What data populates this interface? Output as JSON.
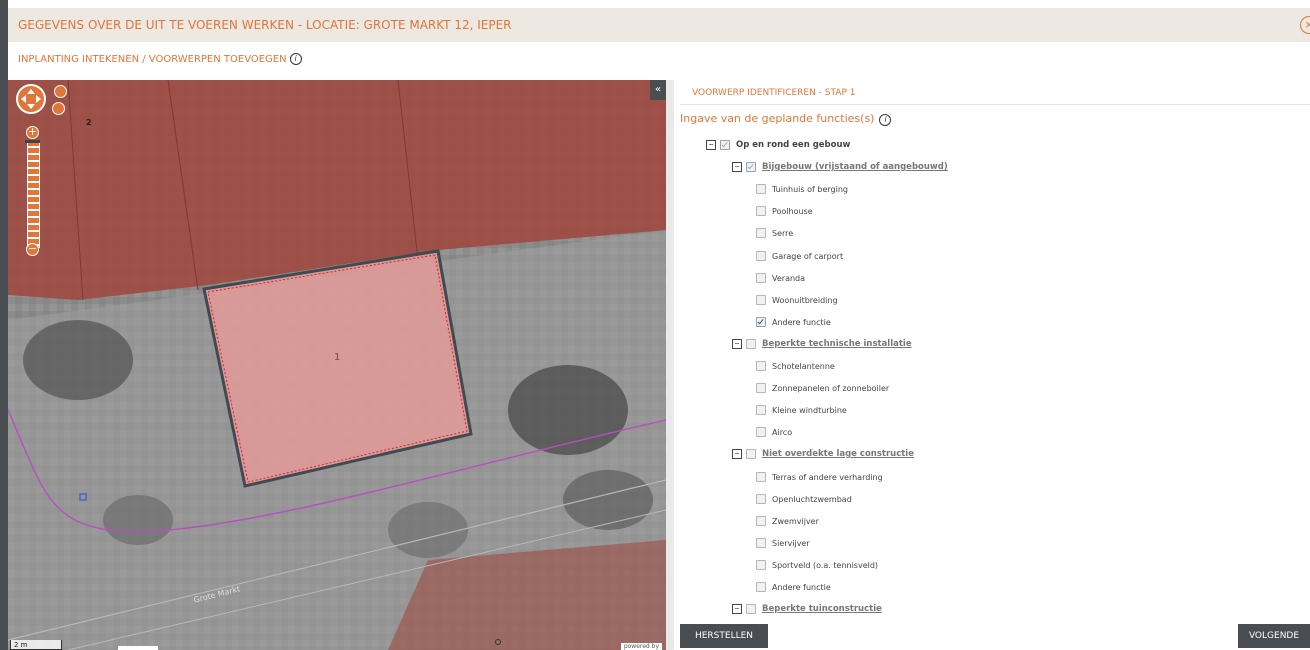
{
  "header": {
    "title": "GEGEVENS OVER DE UIT TE VOEREN WERKEN - LOCATIE: GROTE MARKT 12, IEPER",
    "close_icon": "close-icon"
  },
  "subtitle": {
    "text": "INPLANTING INTEKENEN / VOORWERPEN TOEVOEGEN",
    "info_glyph": "i"
  },
  "map": {
    "street_label": "Grote Markt",
    "parcel_number": "2",
    "object_number": "1",
    "scale_label": "2 m",
    "powered_by": "powered by",
    "collapse_glyph": "«"
  },
  "panel": {
    "step_title": "VOORWERP IDENTIFICEREN - STAP 1",
    "question": "Ingave van de geplande functies(s)",
    "info_glyph": "i",
    "tree": [
      {
        "label": "Op en rond een gebouw",
        "style": "bold",
        "level": 0,
        "toggle": "−",
        "checked": true,
        "grey": true
      },
      {
        "label": "Bijgebouw (vrijstaand of aangebouwd)",
        "style": "link",
        "level": 1,
        "toggle": "−",
        "checked": true,
        "grey": true
      },
      {
        "label": "Tuinhuis of berging",
        "style": "",
        "level": 2,
        "checked": false
      },
      {
        "label": "Poolhouse",
        "style": "",
        "level": 2,
        "checked": false
      },
      {
        "label": "Serre",
        "style": "",
        "level": 2,
        "checked": false
      },
      {
        "label": "Garage of carport",
        "style": "",
        "level": 2,
        "checked": false
      },
      {
        "label": "Veranda",
        "style": "",
        "level": 2,
        "checked": false
      },
      {
        "label": "Woonuitbreiding",
        "style": "",
        "level": 2,
        "checked": false
      },
      {
        "label": "Andere functie",
        "style": "",
        "level": 2,
        "checked": true
      },
      {
        "label": "Beperkte technische installatie",
        "style": "link",
        "level": 1,
        "toggle": "−",
        "checked": false
      },
      {
        "label": "Schotelantenne",
        "style": "",
        "level": 2,
        "checked": false
      },
      {
        "label": "Zonnepanelen of zonneboiler",
        "style": "",
        "level": 2,
        "checked": false
      },
      {
        "label": "Kleine windturbine",
        "style": "",
        "level": 2,
        "checked": false
      },
      {
        "label": "Airco",
        "style": "",
        "level": 2,
        "checked": false
      },
      {
        "label": "Niet overdekte lage constructie",
        "style": "link",
        "level": 1,
        "toggle": "−",
        "checked": false
      },
      {
        "label": "Terras of andere verharding",
        "style": "",
        "level": 2,
        "checked": false
      },
      {
        "label": "Openluchtzwembad",
        "style": "",
        "level": 2,
        "checked": false
      },
      {
        "label": "Zwemvijver",
        "style": "",
        "level": 2,
        "checked": false
      },
      {
        "label": "Siervijver",
        "style": "",
        "level": 2,
        "checked": false
      },
      {
        "label": "Sportveld (o.a. tennisveld)",
        "style": "",
        "level": 2,
        "checked": false
      },
      {
        "label": "Andere functie",
        "style": "",
        "level": 2,
        "checked": false
      },
      {
        "label": "Beperkte tuinconstructie",
        "style": "link",
        "level": 1,
        "toggle": "−",
        "checked": false
      }
    ]
  },
  "buttons": {
    "reset": "HERSTELLEN",
    "next": "VOLGENDE"
  },
  "colors": {
    "accent": "#e0763a",
    "dark": "#4a4d52",
    "building_overlay": "#a0453c",
    "object_fill": "#e49a9a",
    "boundary": "#b74fc0"
  }
}
